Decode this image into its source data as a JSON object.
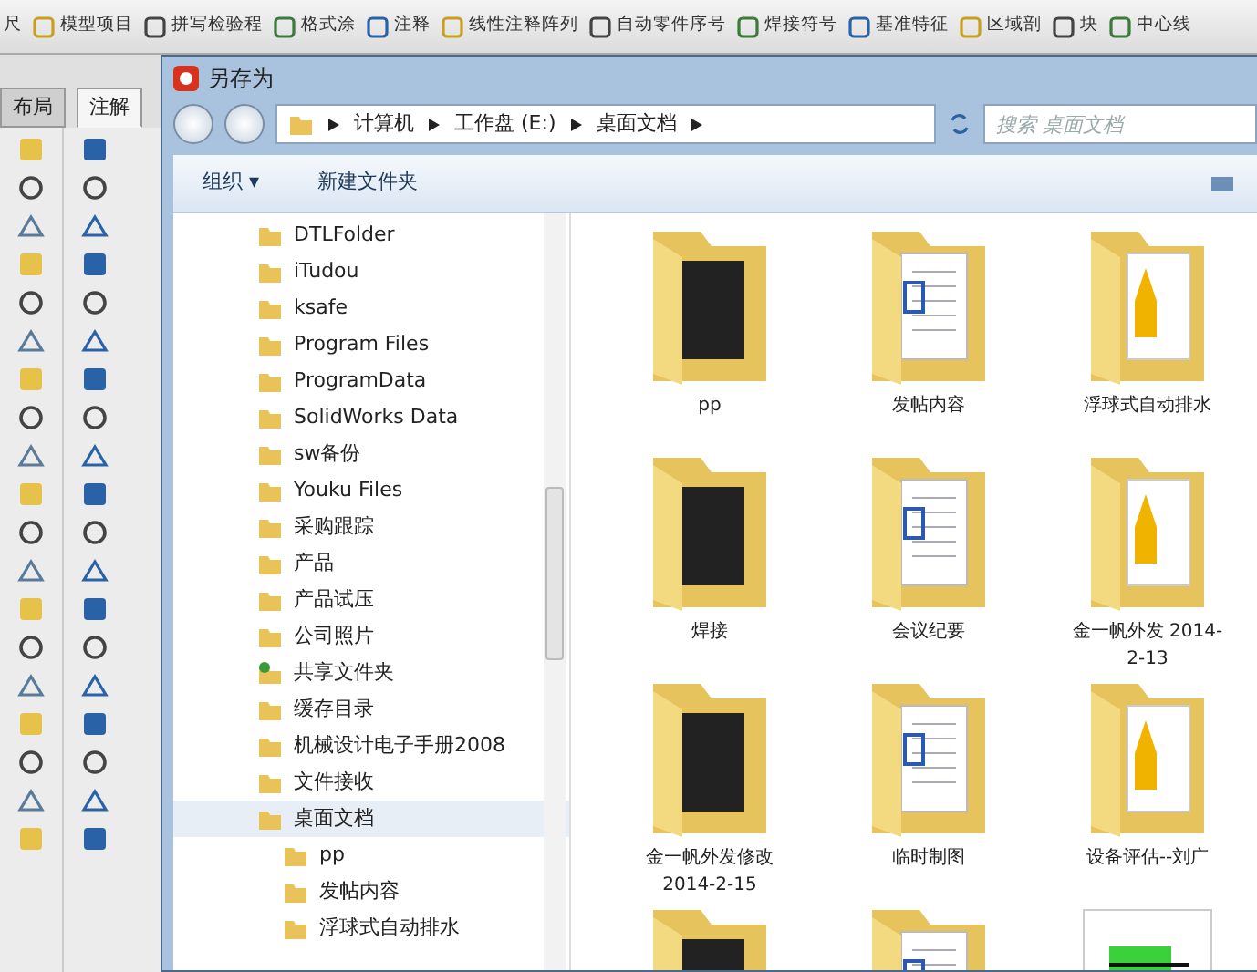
{
  "ribbon": {
    "items": [
      {
        "label": "尺"
      },
      {
        "label": "模型项目"
      },
      {
        "label": "拼写检验程"
      },
      {
        "label": "格式涂"
      },
      {
        "label": "注释"
      },
      {
        "label": "线性注释阵列"
      },
      {
        "label": "自动零件序号"
      },
      {
        "label": "焊接符号"
      },
      {
        "label": "基准特征"
      },
      {
        "label": "区域剖"
      },
      {
        "label": "块"
      },
      {
        "label": "中心线"
      }
    ]
  },
  "side_tabs": [
    {
      "label": "布局",
      "selected": false
    },
    {
      "label": "注解",
      "selected": true
    }
  ],
  "dialog": {
    "title": "另存为",
    "breadcrumb": [
      "计算机",
      "工作盘 (E:)",
      "桌面文档"
    ],
    "search": {
      "placeholder": "搜索 桌面文档"
    },
    "toolbar": {
      "organize": "组织 ▾",
      "new_folder": "新建文件夹"
    },
    "tree": [
      {
        "label": "DTLFolder",
        "kind": "folder",
        "selected": false
      },
      {
        "label": "iTudou",
        "kind": "folder",
        "selected": false
      },
      {
        "label": "ksafe",
        "kind": "folder",
        "selected": false
      },
      {
        "label": "Program Files",
        "kind": "folder",
        "selected": false
      },
      {
        "label": "ProgramData",
        "kind": "folder",
        "selected": false
      },
      {
        "label": "SolidWorks Data",
        "kind": "folder",
        "selected": false
      },
      {
        "label": "sw备份",
        "kind": "folder",
        "selected": false
      },
      {
        "label": "Youku Files",
        "kind": "folder",
        "selected": false
      },
      {
        "label": "采购跟踪",
        "kind": "folder",
        "selected": false
      },
      {
        "label": "产品",
        "kind": "folder",
        "selected": false
      },
      {
        "label": "产品试压",
        "kind": "folder",
        "selected": false
      },
      {
        "label": "公司照片",
        "kind": "folder",
        "selected": false
      },
      {
        "label": "共享文件夹",
        "kind": "shared",
        "selected": false
      },
      {
        "label": "缓存目录",
        "kind": "folder",
        "selected": false
      },
      {
        "label": "机械设计电子手册2008",
        "kind": "folder",
        "selected": false
      },
      {
        "label": "文件接收",
        "kind": "folder",
        "selected": false
      },
      {
        "label": "桌面文档",
        "kind": "folder",
        "selected": true,
        "children": [
          {
            "label": "pp",
            "kind": "folder",
            "selected": false
          },
          {
            "label": "发帖内容",
            "kind": "folder",
            "selected": false
          },
          {
            "label": "浮球式自动排水",
            "kind": "folder",
            "selected": false
          }
        ]
      }
    ],
    "files": [
      {
        "name": "pp",
        "kind": "folder"
      },
      {
        "name": "发帖内容",
        "kind": "folder"
      },
      {
        "name": "浮球式自动排水",
        "kind": "folder"
      },
      {
        "name": "焊接",
        "kind": "folder"
      },
      {
        "name": "会议纪要",
        "kind": "folder"
      },
      {
        "name": "金一帆外发 2014-2-13",
        "kind": "folder"
      },
      {
        "name": "金一帆外发修改 2014-2-15",
        "kind": "folder"
      },
      {
        "name": "临时制图",
        "kind": "folder"
      },
      {
        "name": "设备评估--刘广",
        "kind": "folder"
      },
      {
        "kind": "folder"
      },
      {
        "kind": "folder"
      },
      {
        "kind": "image"
      }
    ]
  }
}
